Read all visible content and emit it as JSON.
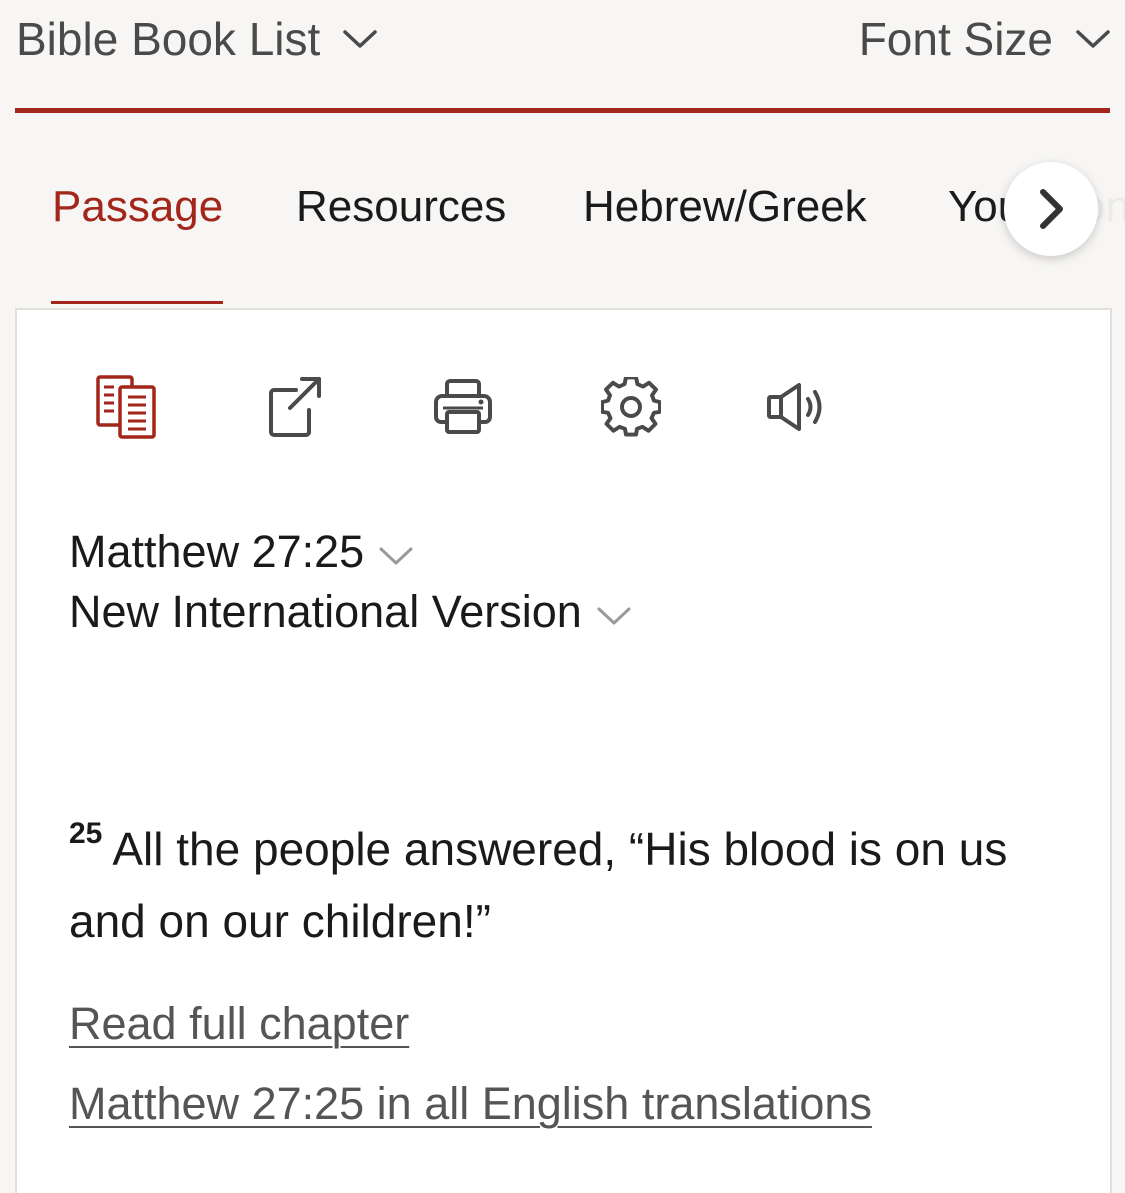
{
  "topbar": {
    "book_list_label": "Bible Book List",
    "font_size_label": "Font Size"
  },
  "tabs": [
    {
      "label": "Passage",
      "active": true
    },
    {
      "label": "Resources",
      "active": false
    },
    {
      "label": "Hebrew/Greek",
      "active": false
    },
    {
      "label": "Your Content",
      "active": false
    }
  ],
  "toolbar": {
    "icons": [
      "parallel-view-icon",
      "share-icon",
      "print-icon",
      "settings-icon",
      "audio-icon"
    ]
  },
  "passage": {
    "reference": "Matthew 27:25",
    "version": "New International Version",
    "verse_number": "25",
    "verse_text": "All the people answered, “His blood is on us and on our children!”"
  },
  "links": {
    "read_full_chapter": "Read full chapter",
    "all_translations": "Matthew 27:25 in all English translations"
  },
  "colors": {
    "accent": "#a3261b",
    "background": "#f7f6f4",
    "panel": "#ffffff",
    "link": "#555555",
    "icon": "#4a4a4a"
  }
}
